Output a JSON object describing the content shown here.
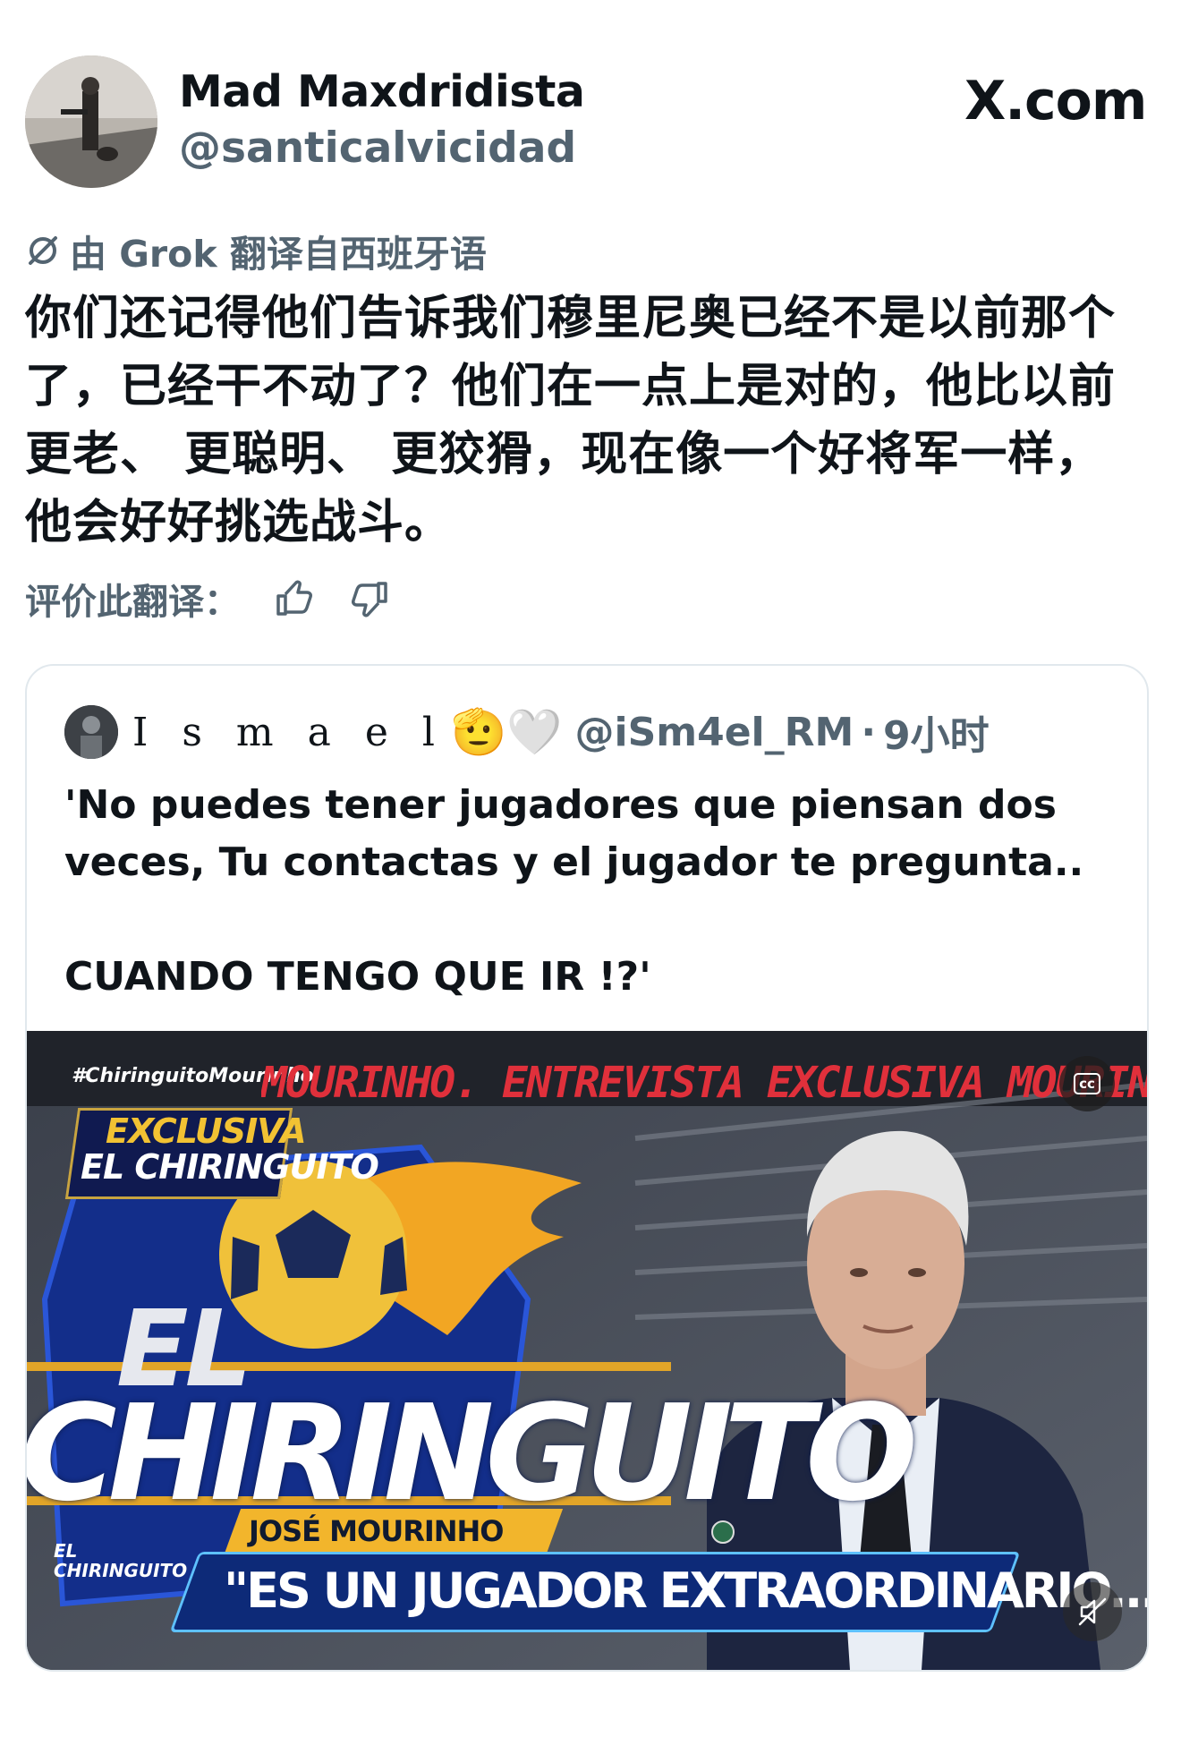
{
  "author": {
    "display_name": "Mad Maxdridista",
    "handle": "@santicalvicidad"
  },
  "brand": "X.com",
  "translation": {
    "translated_by": "由 Grok 翻译自西班牙语",
    "text": "你们还记得他们告诉我们穆里尼奥已经不是以前那个了，已经干不动了？他们在一点上是对的，他比以前更老、 更聪明、 更狡猾，现在像一个好将军一样，他会好好挑选战斗。",
    "rate_label": "评价此翻译："
  },
  "quote": {
    "name": "I s m a e l",
    "emoji": "🫡🤍",
    "handle": "@iSm4el_RM",
    "dot": "·",
    "time": "9小时",
    "text_line1": "'No puedes tener jugadores que piensan dos veces, Tu contactas y el jugador te pregunta..",
    "text_line2": "CUANDO TENGO QUE IR !?'",
    "video": {
      "hashtag": "#ChiringuitoMourinho",
      "ticker": "MOURINHO. ENTREVISTA EXCLUSIVA MOURINHO",
      "cc_label": "cc",
      "badge_line1": "EXCLUSIVA",
      "badge_line2": "EL CHIRINGUITO",
      "logo_el": "EL",
      "logo_chiringuito": "CHIRINGUITO",
      "name_bar": "JOSÉ MOURINHO",
      "quote_bar": "\"ES UN JUGADOR EXTRAORDINARIO...",
      "mini_logo_1": "EL",
      "mini_logo_2": "CHIRINGUITO"
    }
  },
  "colors": {
    "text": "#0f1419",
    "secondary": "#536471",
    "border": "#e1e8ed",
    "ticker_red": "#e0303b",
    "badge_gold": "#f2b52c",
    "quote_bar_blue": "#0d2a78"
  },
  "icons": [
    "grok-translate-icon",
    "thumbs-up-icon",
    "thumbs-down-icon",
    "closed-captions-icon",
    "mute-icon"
  ]
}
